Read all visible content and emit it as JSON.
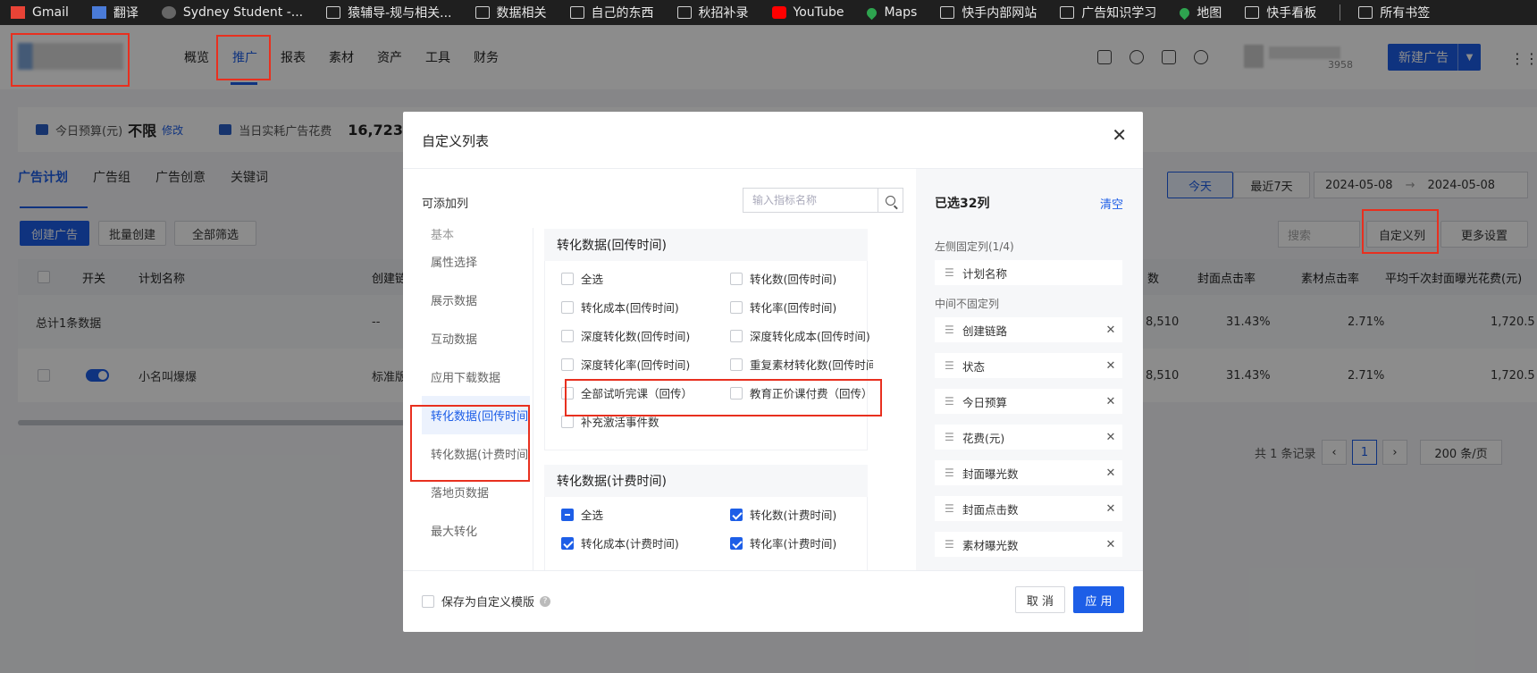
{
  "bookmarks": [
    {
      "icon": "gmail-icon",
      "label": "Gmail"
    },
    {
      "icon": "translate-icon",
      "label": "翻译"
    },
    {
      "icon": "owl-icon",
      "label": "Sydney Student -..."
    },
    {
      "icon": "folder-icon",
      "label": "猿辅导-规与相关..."
    },
    {
      "icon": "folder-icon",
      "label": "数据相关"
    },
    {
      "icon": "folder-icon",
      "label": "自己的东西"
    },
    {
      "icon": "folder-icon",
      "label": "秋招补录"
    },
    {
      "icon": "youtube-icon",
      "label": "YouTube"
    },
    {
      "icon": "maps-icon",
      "label": "Maps"
    },
    {
      "icon": "folder-icon",
      "label": "快手内部网站"
    },
    {
      "icon": "folder-icon",
      "label": "广告知识学习"
    },
    {
      "icon": "maps-icon",
      "label": "地图"
    },
    {
      "icon": "folder-icon",
      "label": "快手看板"
    }
  ],
  "bookmarks_all": "所有书签",
  "nav": {
    "items": [
      "概览",
      "推广",
      "报表",
      "素材",
      "资产",
      "工具",
      "财务"
    ],
    "active": "推广",
    "account_id": "3958",
    "new_ad": "新建广告"
  },
  "budget": {
    "today_budget_label": "今日预算(元)",
    "today_budget_value": "不限",
    "edit": "修改",
    "spend_label": "当日实耗广告花费",
    "spend_value": "16,723."
  },
  "tabs": [
    "广告计划",
    "广告组",
    "广告创意",
    "关键词"
  ],
  "toolbar": {
    "create": "创建广告",
    "batch": "批量创建",
    "filter": "全部筛选",
    "today": "今天",
    "last7": "最近7天",
    "date_from": "2024-05-08",
    "date_to": "2024-05-08",
    "search_placeholder": "搜索",
    "custom_cols": "自定义列",
    "more": "更多设置"
  },
  "table": {
    "headers": [
      "开关",
      "计划名称",
      "创建链",
      "数",
      "封面点击率",
      "素材点击率",
      "平均千次封面曝光花费(元)"
    ],
    "sum_label": "总计1条数据",
    "sum_link": "--",
    "sum_cells": [
      "8,510",
      "31.43%",
      "2.71%",
      "1,720.5"
    ],
    "row": {
      "name": "小名叫爆爆",
      "link": "标准版",
      "cells": [
        "8,510",
        "31.43%",
        "2.71%",
        "1,720.5"
      ]
    }
  },
  "pager": {
    "total": "共 1 条记录",
    "page": "1",
    "size": "200 条/页"
  },
  "modal": {
    "title": "自定义列表",
    "left_label": "可添加列",
    "search_placeholder": "输入指标名称",
    "categories": [
      "基本",
      "属性选择",
      "展示数据",
      "互动数据",
      "应用下载数据",
      "转化数据(回传时间)",
      "转化数据(计费时间)",
      "落地页数据",
      "最大转化"
    ],
    "active_category": "转化数据(回传时间)",
    "groups": [
      {
        "title": "转化数据(回传时间)",
        "options": [
          {
            "label": "全选",
            "state": "unchecked"
          },
          {
            "label": "转化数(回传时间)",
            "state": "unchecked"
          },
          {
            "label": "转化成本(回传时间)",
            "state": "unchecked"
          },
          {
            "label": "转化率(回传时间)",
            "state": "unchecked"
          },
          {
            "label": "深度转化数(回传时间)",
            "state": "unchecked"
          },
          {
            "label": "深度转化成本(回传时间)",
            "state": "unchecked"
          },
          {
            "label": "深度转化率(回传时间)",
            "state": "unchecked"
          },
          {
            "label": "重复素材转化数(回传时间)",
            "state": "unchecked"
          },
          {
            "label": "全部试听完课（回传）",
            "state": "unchecked"
          },
          {
            "label": "教育正价课付费（回传）",
            "state": "unchecked"
          },
          {
            "label": "补充激活事件数",
            "state": "unchecked"
          }
        ]
      },
      {
        "title": "转化数据(计费时间)",
        "options": [
          {
            "label": "全选",
            "state": "indeterminate"
          },
          {
            "label": "转化数(计费时间)",
            "state": "checked"
          },
          {
            "label": "转化成本(计费时间)",
            "state": "checked"
          },
          {
            "label": "转化率(计费时间)",
            "state": "checked"
          }
        ]
      }
    ],
    "selected_title": "已选32列",
    "clear": "清空",
    "fixed_label": "左侧固定列(1/4)",
    "fixed_items": [
      "计划名称"
    ],
    "middle_label": "中间不固定列",
    "middle_items": [
      "创建链路",
      "状态",
      "今日预算",
      "花费(元)",
      "封面曝光数",
      "封面点击数",
      "素材曝光数"
    ],
    "save_template": "保存为自定义模版",
    "cancel": "取 消",
    "apply": "应 用"
  },
  "colors": {
    "accent": "#1d5ee7",
    "highlight": "#e8301f"
  }
}
